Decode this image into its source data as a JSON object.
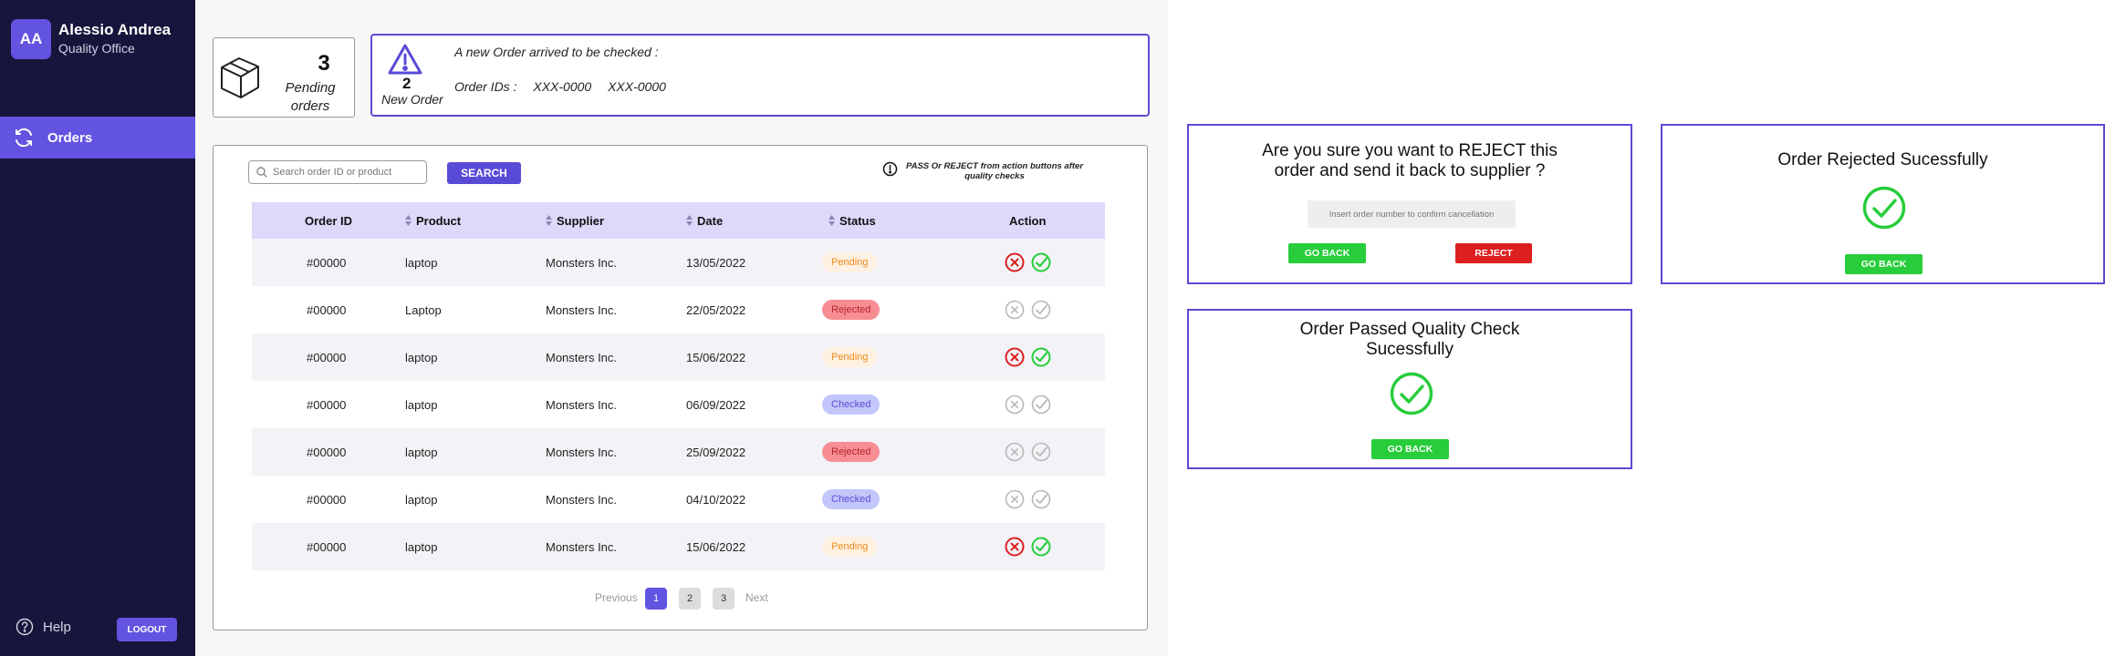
{
  "user": {
    "initials": "AA",
    "name": "Alessio Andrea",
    "role": "Quality Office"
  },
  "nav": {
    "orders_label": "Orders"
  },
  "footer": {
    "help_label": "Help",
    "logout_label": "LOGOUT"
  },
  "pending": {
    "count": "3",
    "label_line1": "Pending",
    "label_line2": "orders"
  },
  "new_order": {
    "count": "2",
    "label": "New Order",
    "message": "A new Order arrived to be checked :",
    "ids_label": "Order IDs :",
    "ids": [
      "XXX-0000",
      "XXX-0000"
    ]
  },
  "search": {
    "placeholder": "Search order ID or product",
    "button_label": "SEARCH"
  },
  "hint": "PASS Or REJECT from action buttons after quality checks",
  "table": {
    "columns": [
      "Order ID",
      "Product",
      "Supplier",
      "Date",
      "Status",
      "Action"
    ],
    "rows": [
      {
        "order_id": "#00000",
        "product": "laptop",
        "supplier": "Monsters Inc.",
        "date": "13/05/2022",
        "status": "Pending",
        "actions_enabled": true
      },
      {
        "order_id": "#00000",
        "product": "Laptop",
        "supplier": "Monsters Inc.",
        "date": "22/05/2022",
        "status": "Rejected",
        "actions_enabled": false
      },
      {
        "order_id": "#00000",
        "product": "laptop",
        "supplier": "Monsters Inc.",
        "date": "15/06/2022",
        "status": "Pending",
        "actions_enabled": true
      },
      {
        "order_id": "#00000",
        "product": "laptop",
        "supplier": "Monsters Inc.",
        "date": "06/09/2022",
        "status": "Checked",
        "actions_enabled": false
      },
      {
        "order_id": "#00000",
        "product": "laptop",
        "supplier": "Monsters Inc.",
        "date": "25/09/2022",
        "status": "Rejected",
        "actions_enabled": false
      },
      {
        "order_id": "#00000",
        "product": "laptop",
        "supplier": "Monsters Inc.",
        "date": "04/10/2022",
        "status": "Checked",
        "actions_enabled": false
      },
      {
        "order_id": "#00000",
        "product": "laptop",
        "supplier": "Monsters Inc.",
        "date": "15/06/2022",
        "status": "Pending",
        "actions_enabled": true
      }
    ]
  },
  "pagination": {
    "previous": "Previous",
    "next": "Next",
    "pages": [
      "1",
      "2",
      "3"
    ],
    "current_page": "1"
  },
  "reject_modal": {
    "title_line1": "Are you sure you want to REJECT this",
    "title_line2": "order and send it back to supplier ?",
    "input_placeholder": "Insert order number to confirm cancellation",
    "go_back_label": "GO BACK",
    "reject_label": "REJECT"
  },
  "rejected_modal": {
    "title": "Order Rejected Sucessfully",
    "go_back_label": "GO BACK"
  },
  "passed_modal": {
    "title_line1": "Order Passed Quality Check",
    "title_line2": "Sucessfully",
    "go_back_label": "GO BACK"
  },
  "colors": {
    "sidebar": "#17153b",
    "accent": "#6253e0",
    "table_header": "#dcd9fb",
    "pending": "#ec8a1e",
    "rejected": "#f78e94",
    "checked": "#c2c6fb",
    "success": "#27cd3b",
    "danger": "#dc1f1f"
  }
}
